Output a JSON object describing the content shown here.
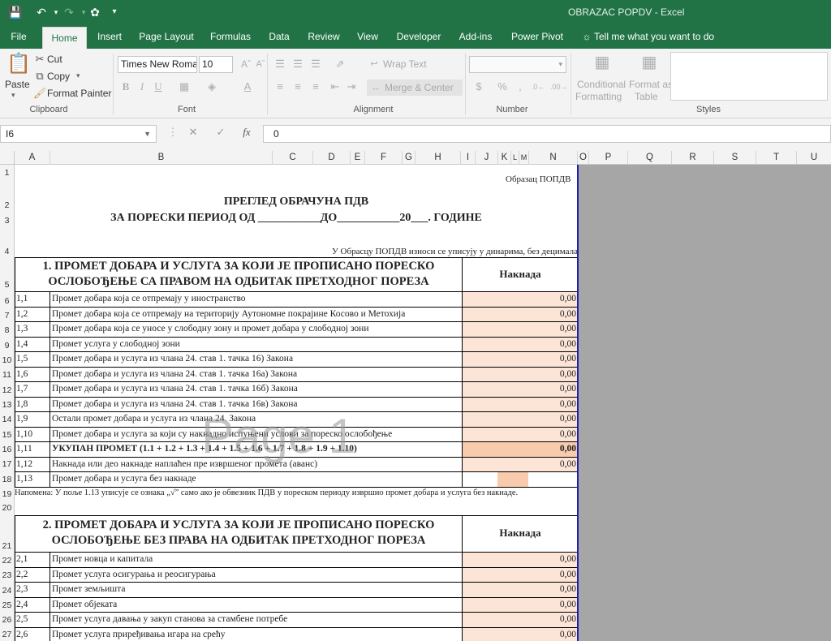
{
  "titlebar": {
    "doc_title": "OBRAZAC POPDV  -  Excel"
  },
  "tabs": [
    "File",
    "Home",
    "Insert",
    "Page Layout",
    "Formulas",
    "Data",
    "Review",
    "View",
    "Developer",
    "Add-ins",
    "Power Pivot",
    "Tell me what you want to do"
  ],
  "ribbon": {
    "paste": "Paste",
    "cut": "Cut",
    "copy": "Copy",
    "format_painter": "Format Painter",
    "font_name": "Times New Roma",
    "font_size": "10",
    "wrap_text": "Wrap Text",
    "merge_center": "Merge & Center",
    "conditional": "Conditional",
    "formatting": "Formatting",
    "format_as": "Format as",
    "table": "Table",
    "groups": {
      "clipboard": "Clipboard",
      "font": "Font",
      "alignment": "Alignment",
      "number": "Number",
      "styles": "Styles"
    }
  },
  "formula_bar": {
    "cell_ref": "I6",
    "value": "0"
  },
  "columns": [
    "A",
    "B",
    "C",
    "D",
    "E",
    "F",
    "G",
    "H",
    "I",
    "J",
    "K",
    "L",
    "M",
    "N",
    "O",
    "P",
    "Q",
    "R",
    "S",
    "T",
    "U"
  ],
  "rows": [
    "1",
    "2",
    "3",
    "4",
    "5",
    "6",
    "7",
    "8",
    "9",
    "10",
    "11",
    "12",
    "13",
    "14",
    "15",
    "16",
    "17",
    "18",
    "19",
    "20",
    "21",
    "22",
    "23",
    "24",
    "25",
    "26",
    "27"
  ],
  "sheet": {
    "form_label": "Образац ПОПДВ",
    "title1": "ПРЕГЛЕД ОБРАЧУНА ПДВ",
    "title2": "ЗА ПОРЕСКИ ПЕРИОД ОД ___________ДО___________20___. ГОДИНЕ",
    "note_dinars": "У Обрасцу ПОПДВ износи се уписују у динарима, без децимала",
    "sec1_line1": "1. ПРОМЕТ ДОБАРА И УСЛУГА ЗА КОЈИ ЈЕ ПРОПИСАНО ПОРЕСКО",
    "sec1_line2": "ОСЛОБОЂЕЊЕ СА ПРАВОМ НА ОДБИТАК ПРЕТХОДНОГ ПОРЕЗА",
    "nakn": "Накнада",
    "sec1_items": [
      {
        "code": "1,1",
        "text": "Промет добара која се отпремају у иностранство",
        "amount": "0,00"
      },
      {
        "code": "1,2",
        "text": "Промет добара која се отпремају на територију Аутономне покрајине Косово и Метохија",
        "amount": "0,00"
      },
      {
        "code": "1,3",
        "text": "Промет добара која се уносе у слободну зону и промет добара у слободној зони",
        "amount": "0,00"
      },
      {
        "code": "1,4",
        "text": "Промет услуга у слободној зони",
        "amount": "0,00"
      },
      {
        "code": "1,5",
        "text": "Промет добара и услуга из члана 24. став 1. тачка 16) Закона",
        "amount": "0,00"
      },
      {
        "code": "1,6",
        "text": "Промет добара и услуга из члана 24. став 1. тачка 16а) Закона",
        "amount": "0,00"
      },
      {
        "code": "1,7",
        "text": "Промет добара и услуга из члана 24. став 1. тачка 16б) Закона",
        "amount": "0,00"
      },
      {
        "code": "1,8",
        "text": "Промет добара и услуга из члана 24. став 1. тачка 16в) Закона",
        "amount": "0,00"
      },
      {
        "code": "1,9",
        "text": "Остали промет добара и услуга из члана 24. Закона",
        "amount": "0,00"
      },
      {
        "code": "1,10",
        "text": "Промет добара и услуга за који су накнадно испуњени услови за пореско ослобођење",
        "amount": "0,00"
      },
      {
        "code": "1,11",
        "text": "УКУПАН ПРОМЕТ (1.1 + 1.2 + 1.3 + 1.4 + 1.5 + 1.6 + 1.7 + 1.8 + 1.9 + 1.10)",
        "amount": "0,00"
      },
      {
        "code": "1,12",
        "text": "Накнада или део накнаде наплаћен пре извршеног промета (аванс)",
        "amount": "0,00"
      },
      {
        "code": "1,13",
        "text": "Промет добара и услуга без накнаде",
        "amount": ""
      }
    ],
    "napomena": "Напомена: У поље 1.13 уписује се ознака „√” само ако је обвезник ПДВ у пореском периоду извршио промет добара и услуга без накнаде.",
    "sec2_line1": "2. ПРОМЕТ ДОБАРА И УСЛУГА ЗА КОЈИ ЈЕ ПРОПИСАНО ПОРЕСКО",
    "sec2_line2": "ОСЛОБОЂЕЊЕ БЕЗ ПРАВА НА ОДБИТАК ПРЕТХОДНОГ ПОРЕЗА",
    "sec2_items": [
      {
        "code": "2,1",
        "text": "Промет новца и капитала",
        "amount": "0,00"
      },
      {
        "code": "2,2",
        "text": "Промет услуга осигурања и реосигурања",
        "amount": "0,00"
      },
      {
        "code": "2,3",
        "text": "Промет земљишта",
        "amount": "0,00"
      },
      {
        "code": "2,4",
        "text": "Промет објеката",
        "amount": "0,00"
      },
      {
        "code": "2,5",
        "text": "Промет услуга давања у закуп станова за стамбене потребе",
        "amount": "0,00"
      },
      {
        "code": "2,6",
        "text": "Промет услуга приређивања игара на срећу",
        "amount": "0,00"
      }
    ],
    "watermark": "Page 1"
  },
  "colors": {
    "excel_green": "#217346",
    "amount_fill": "#fce4d6",
    "total_fill": "#f8cbad",
    "page_border": "#1f1fb0"
  }
}
